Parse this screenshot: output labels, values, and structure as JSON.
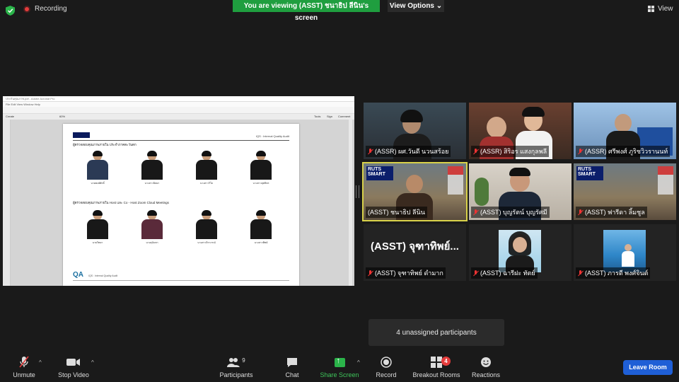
{
  "topbar": {
    "recording_label": "Recording",
    "banner_text": "You are viewing (ASST) ชนาธิป ลีนิน's screen",
    "view_options_label": "View Options ⌄",
    "view_label": "View"
  },
  "shared_doc": {
    "window_title": "ประกันคุณภาพ.pdf - Adobe Acrobat Pro",
    "menu": "File  Edit  View  Window  Help",
    "toolbar_items": [
      "Create",
      "Tools",
      "Sign",
      "Comment"
    ],
    "zoom": "60%",
    "header_right": "IQS : Internal Quality Audit",
    "section1": "ผู้ตรวจสอบคุณภาพภายใน ประจำภาคตะวันตก",
    "section2": "ผู้ตรวจสอบคุณภาพภายใน Host และ Co - Host Zoom Cloud Meetings",
    "row1_captions": [
      "นายพงษ์ศักดิ์",
      "นางสาวนิตยา",
      "นางสาววิไล",
      "นางสาวสุทธิพร"
    ],
    "row2_captions": [
      "นายวิทยา",
      "นางสุนันทา",
      "นางสาวจิราภรณ์",
      "นางสาวทิพย์"
    ],
    "footer_logo": "QA",
    "footer_text": "IQS : Internal Quality Audit"
  },
  "participants": [
    {
      "name": "(ASSR) ผศ.วันดี นวนสร้อย",
      "muted": true
    },
    {
      "name": "(ASSR) สิริอร แสงกุลพลี",
      "muted": true
    },
    {
      "name": "(ASSR) ศรีพงศ์ ภูริชวิวรานนท์",
      "muted": true
    },
    {
      "name": "(ASST) ชนาธิป ลีนิน",
      "muted": false,
      "active": true
    },
    {
      "name": "(ASST) บุญรัตน์ บุญรัศมี",
      "muted": true
    },
    {
      "name": "(ASST) ฟารีดา ลิ้มชูล",
      "muted": true
    },
    {
      "name": "(ASST) จุฑาทิพย์ ดำมาก",
      "muted": true,
      "big_text": "(ASST) จุฑาทิพย์..."
    },
    {
      "name": "(ASST) ฉารีฝะ ทัตย์",
      "muted": true
    },
    {
      "name": "(ASST) ภารดี พงศ์จินต์",
      "muted": true
    }
  ],
  "tile_logo_text": "RUTS SMART",
  "popup_text": "4 unassigned participants",
  "toolbar": {
    "unmute": "Unmute",
    "stop_video": "Stop Video",
    "participants": "Participants",
    "participants_count": "9",
    "chat": "Chat",
    "share_screen": "Share Screen",
    "record": "Record",
    "breakout_rooms": "Breakout Rooms",
    "breakout_badge": "4",
    "reactions": "Reactions",
    "leave": "Leave Room"
  },
  "colors": {
    "banner_green": "#1f9e3f",
    "leave_blue": "#1f5fd6",
    "active_speaker": "#d9d24a",
    "muted_red": "#e53c3c"
  }
}
